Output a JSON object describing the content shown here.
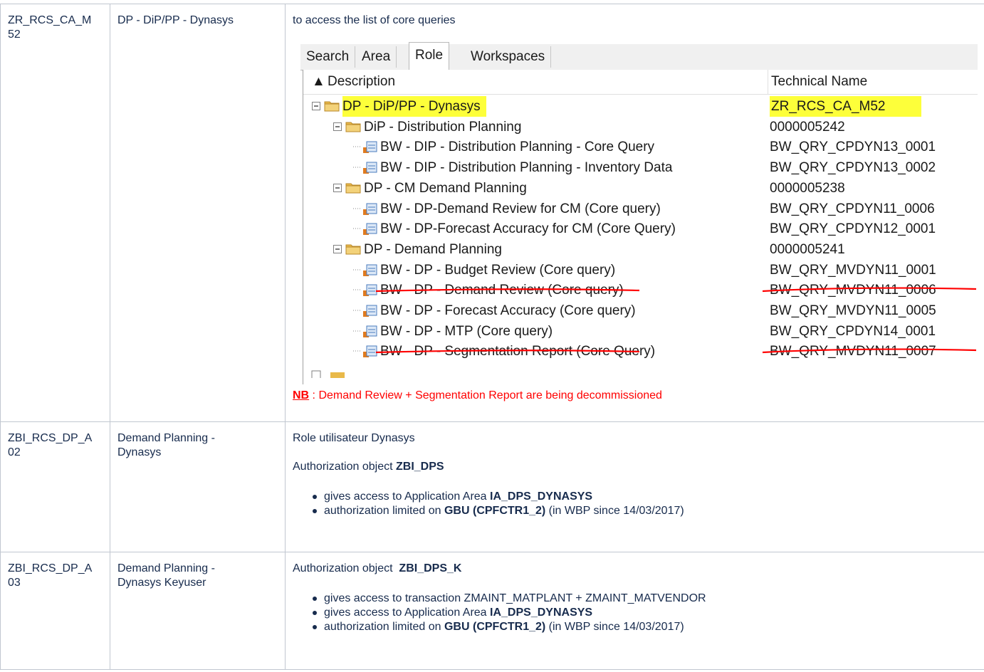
{
  "rows": [
    {
      "code": "ZR_RCS_CA_M52",
      "name": "DP - DiP/PP - Dynasys",
      "intro": "to access the list of core queries",
      "note_label": "NB",
      "note_text": " : Demand Review + Segmentation Report are being decommissioned"
    },
    {
      "code": "ZBI_RCS_DP_A02",
      "name": "Demand Planning - Dynasys",
      "line1": "Role utilisateur Dynasys",
      "auth_prefix": "Authorization object ",
      "auth_obj": "ZBI_DPS",
      "bullets": [
        {
          "pre": "gives access to Application Area ",
          "bold": "IA_DPS_DYNASYS",
          "post": ""
        },
        {
          "pre": "authorization limited on ",
          "bold": "GBU (CPFCTR1_2)",
          "post": " (in WBP since 14/03/2017)"
        }
      ]
    },
    {
      "code": "ZBI_RCS_DP_A03",
      "name": "Demand Planning - Dynasys Keyuser",
      "auth_prefix": "Authorization object  ",
      "auth_obj": "ZBI_DPS_K",
      "bullets": [
        {
          "pre": "gives access to transaction ZMAINT_MATPLANT + ZMAINT_MATVENDOR",
          "bold": "",
          "post": ""
        },
        {
          "pre": "gives access to Application Area ",
          "bold": "IA_DPS_DYNASYS",
          "post": ""
        },
        {
          "pre": "authorization limited on ",
          "bold": "GBU (CPFCTR1_2)",
          "post": " (in WBP since 14/03/2017)"
        }
      ]
    }
  ],
  "screenshot": {
    "tabs": [
      "Search",
      "Area",
      "Role",
      "Workspaces"
    ],
    "active_tab": "Role",
    "col_description": "Description",
    "col_technical": "Technical Name",
    "tree": [
      {
        "level": 0,
        "kind": "folder",
        "label": "DP - DiP/PP - Dynasys",
        "tech": "ZR_RCS_CA_M52",
        "highlight": true
      },
      {
        "level": 1,
        "kind": "folder",
        "label": "DiP - Distribution Planning",
        "tech": "0000005242"
      },
      {
        "level": 2,
        "kind": "query",
        "label": "BW - DIP - Distribution Planning - Core Query",
        "tech": "BW_QRY_CPDYN13_0001"
      },
      {
        "level": 2,
        "kind": "query",
        "label": "BW - DIP - Distribution Planning - Inventory Data",
        "tech": "BW_QRY_CPDYN13_0002"
      },
      {
        "level": 1,
        "kind": "folder",
        "label": "DP - CM Demand Planning",
        "tech": "0000005238"
      },
      {
        "level": 2,
        "kind": "query",
        "label": "BW - DP-Demand Review for CM (Core query)",
        "tech": "BW_QRY_CPDYN11_0006"
      },
      {
        "level": 2,
        "kind": "query",
        "label": "BW - DP-Forecast Accuracy for CM (Core Query)",
        "tech": "BW_QRY_CPDYN12_0001"
      },
      {
        "level": 1,
        "kind": "folder",
        "label": "DP - Demand Planning",
        "tech": "0000005241"
      },
      {
        "level": 2,
        "kind": "query",
        "label": "BW - DP - Budget Review (Core query)",
        "tech": "BW_QRY_MVDYN11_0001"
      },
      {
        "level": 2,
        "kind": "query",
        "label": "BW - DP - Demand Review (Core query)",
        "tech": "BW_QRY_MVDYN11_0006",
        "struck": true
      },
      {
        "level": 2,
        "kind": "query",
        "label": "BW - DP - Forecast Accuracy (Core query)",
        "tech": "BW_QRY_MVDYN11_0005"
      },
      {
        "level": 2,
        "kind": "query",
        "label": "BW - DP - MTP (Core query)",
        "tech": "BW_QRY_CPDYN14_0001"
      },
      {
        "level": 2,
        "kind": "query",
        "label": "BW - DP - Segmentation Report (Core Query)",
        "tech": "BW_QRY_MVDYN11_0007",
        "struck": true
      }
    ],
    "colors": {
      "highlight": "#fdff3a",
      "strike": "#ff0000",
      "folder": "#e9b949"
    }
  }
}
